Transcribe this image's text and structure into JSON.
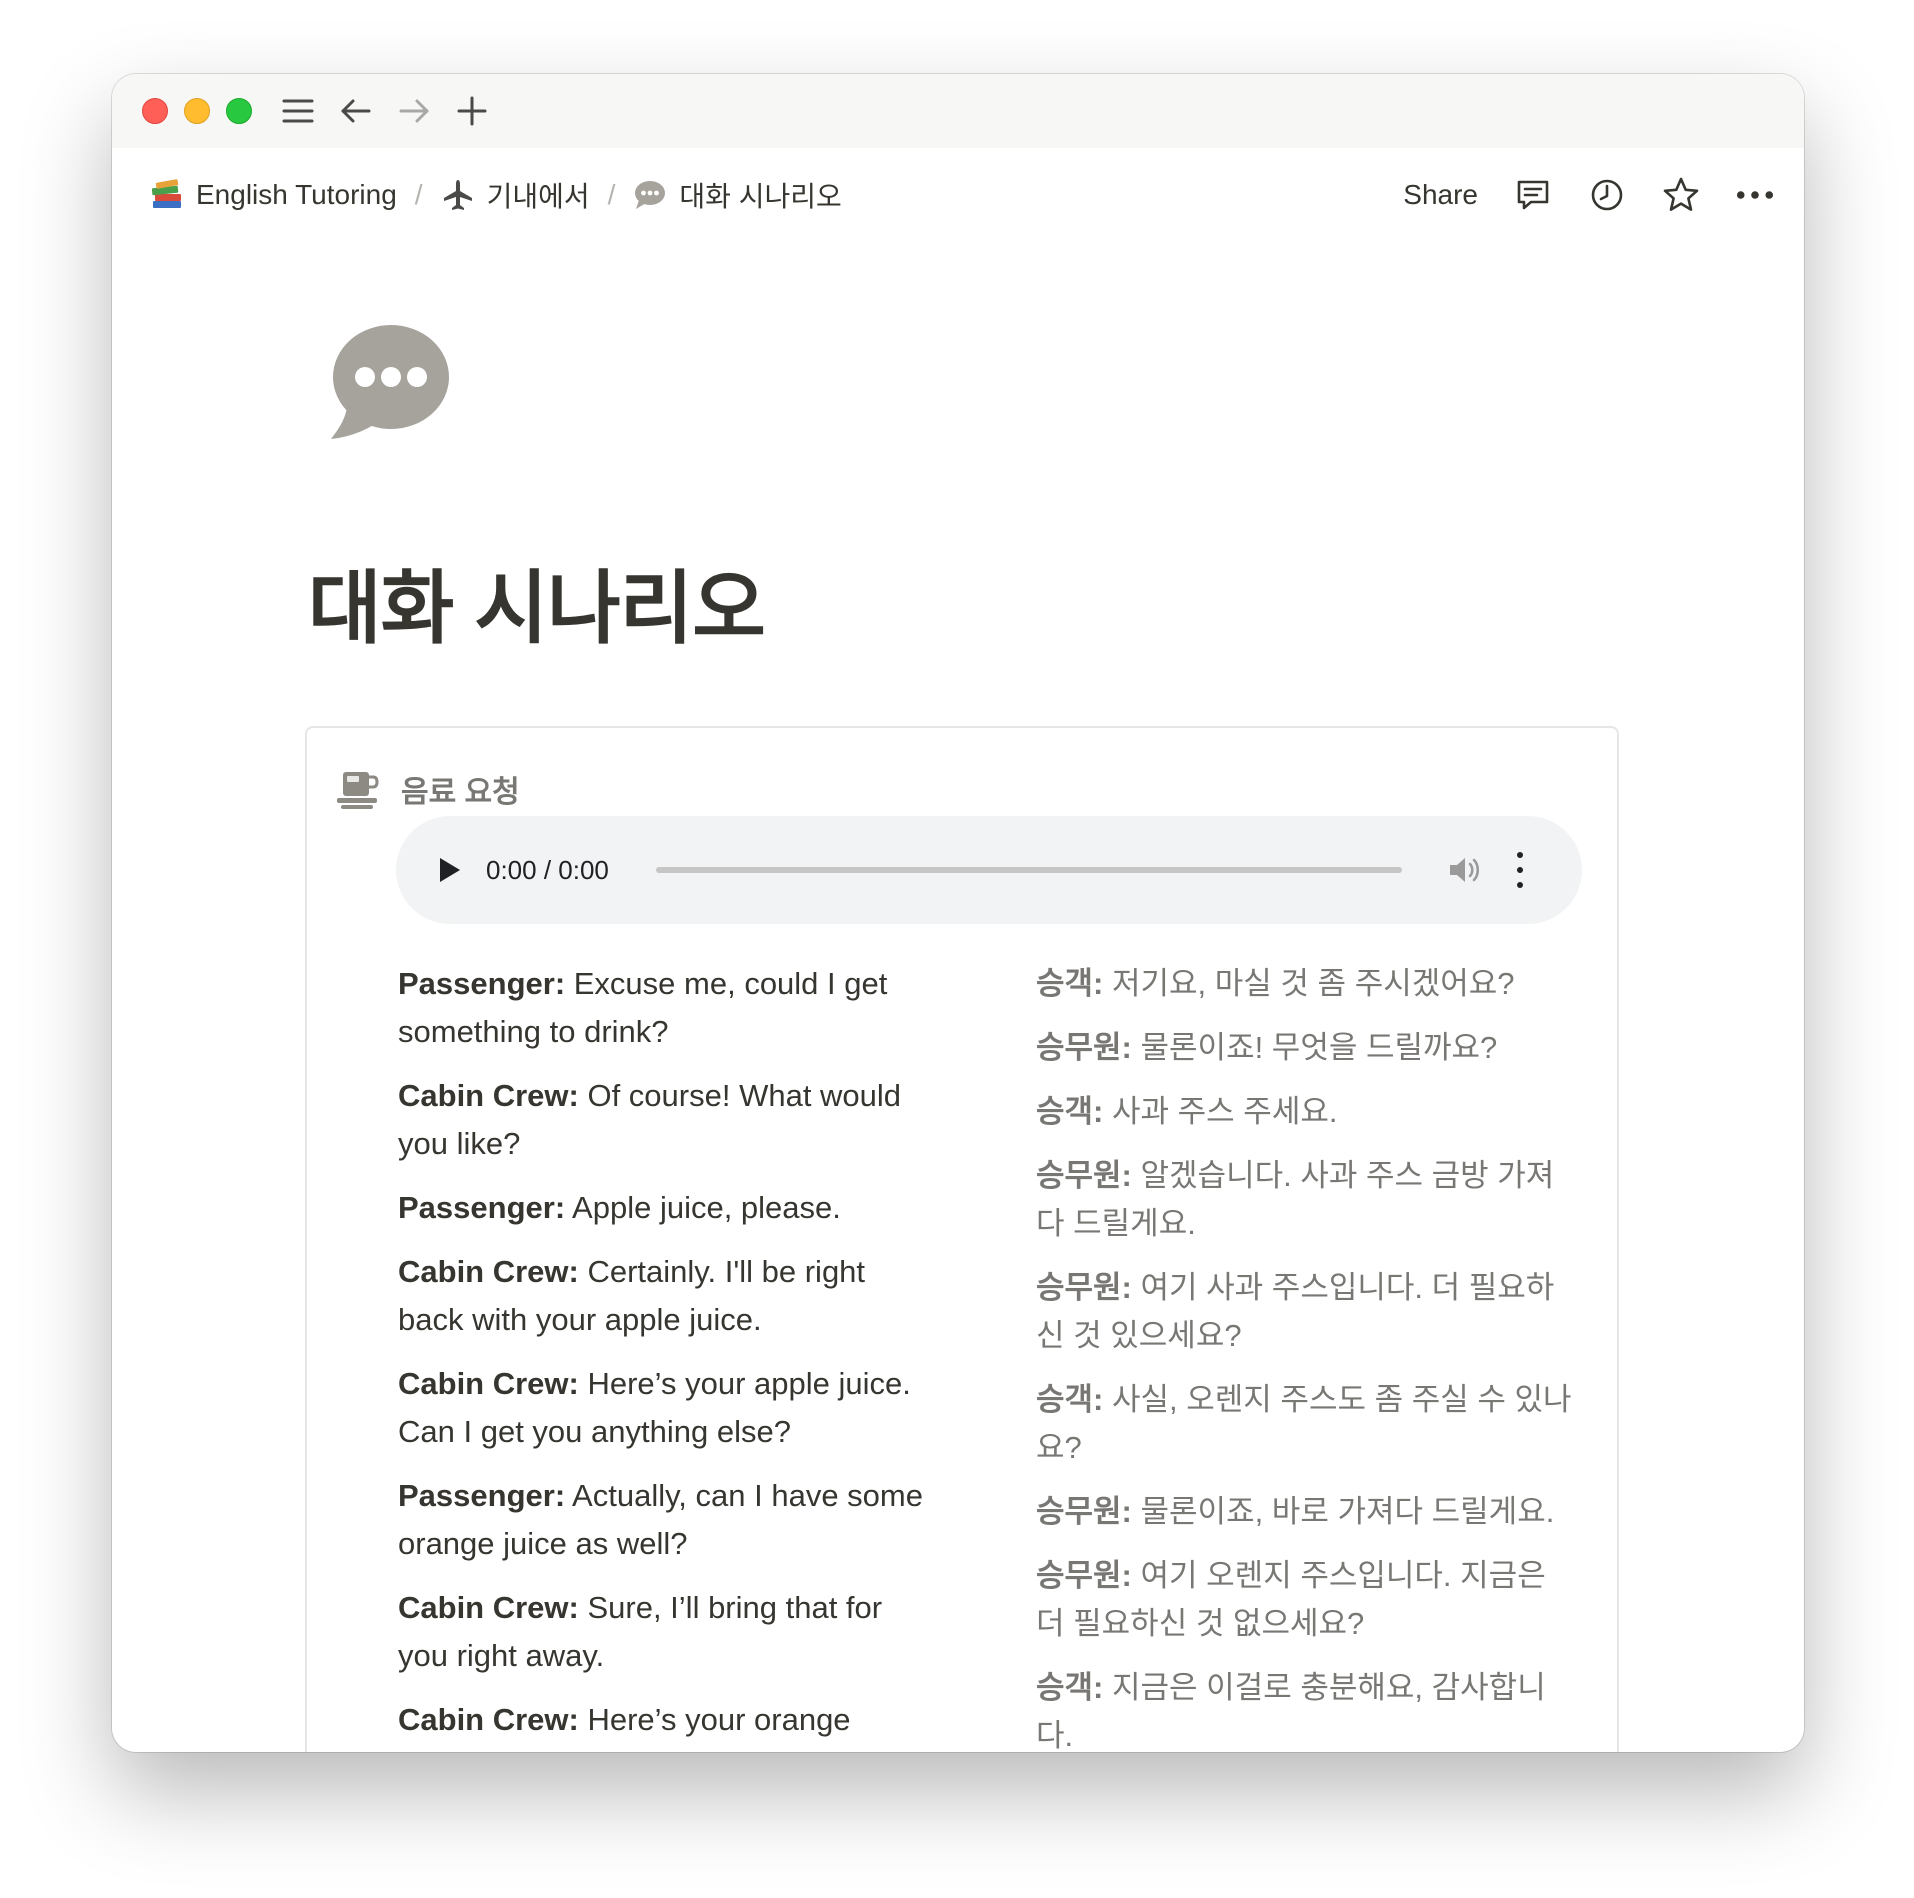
{
  "breadcrumb": {
    "items": [
      {
        "icon": "books-icon",
        "label": "English Tutoring"
      },
      {
        "icon": "airplane-icon",
        "label": "기내에서"
      },
      {
        "icon": "speech-bubble-icon",
        "label": "대화 시나리오"
      }
    ],
    "separator": "/"
  },
  "topbar": {
    "share_label": "Share"
  },
  "page": {
    "title": "대화 시나리오",
    "icon": "speech-bubble-icon"
  },
  "callout": {
    "icon": "coffee-cup-icon",
    "title": "음료 요청"
  },
  "audio": {
    "time": "0:00 / 0:00"
  },
  "dialogue_en": [
    {
      "speaker": "Passenger:",
      "text": " Excuse me, could I get something to drink?"
    },
    {
      "speaker": "Cabin Crew:",
      "text": " Of course! What would you like?"
    },
    {
      "speaker": "Passenger:",
      "text": " Apple juice, please."
    },
    {
      "speaker": "Cabin Crew:",
      "text": " Certainly. I'll be right back with your apple juice."
    },
    {
      "speaker": "Cabin Crew:",
      "text": " Here’s your apple juice. Can I get you anything else?"
    },
    {
      "speaker": "Passenger:",
      "text": " Actually, can I have some orange juice as well?"
    },
    {
      "speaker": "Cabin Crew:",
      "text": " Sure, I’ll bring that for you right away."
    },
    {
      "speaker": "Cabin Crew:",
      "text": " Here’s your orange"
    }
  ],
  "dialogue_ko": [
    {
      "speaker": "승객:",
      "text": " 저기요, 마실 것 좀 주시겠어요?"
    },
    {
      "speaker": "승무원:",
      "text": " 물론이죠! 무엇을 드릴까요?"
    },
    {
      "speaker": "승객:",
      "text": " 사과 주스 주세요."
    },
    {
      "speaker": "승무원:",
      "text": " 알겠습니다. 사과 주스 금방 가져다 드릴게요."
    },
    {
      "speaker": "승무원:",
      "text": " 여기 사과 주스입니다. 더 필요하신 것 있으세요?"
    },
    {
      "speaker": "승객:",
      "text": " 사실, 오렌지 주스도 좀 주실 수 있나요?"
    },
    {
      "speaker": "승무원:",
      "text": " 물론이죠, 바로 가져다 드릴게요."
    },
    {
      "speaker": "승무원:",
      "text": " 여기 오렌지 주스입니다. 지금은 더 필요하신 것 없으세요?"
    },
    {
      "speaker": "승객:",
      "text": " 지금은 이걸로 충분해요, 감사합니다."
    }
  ]
}
